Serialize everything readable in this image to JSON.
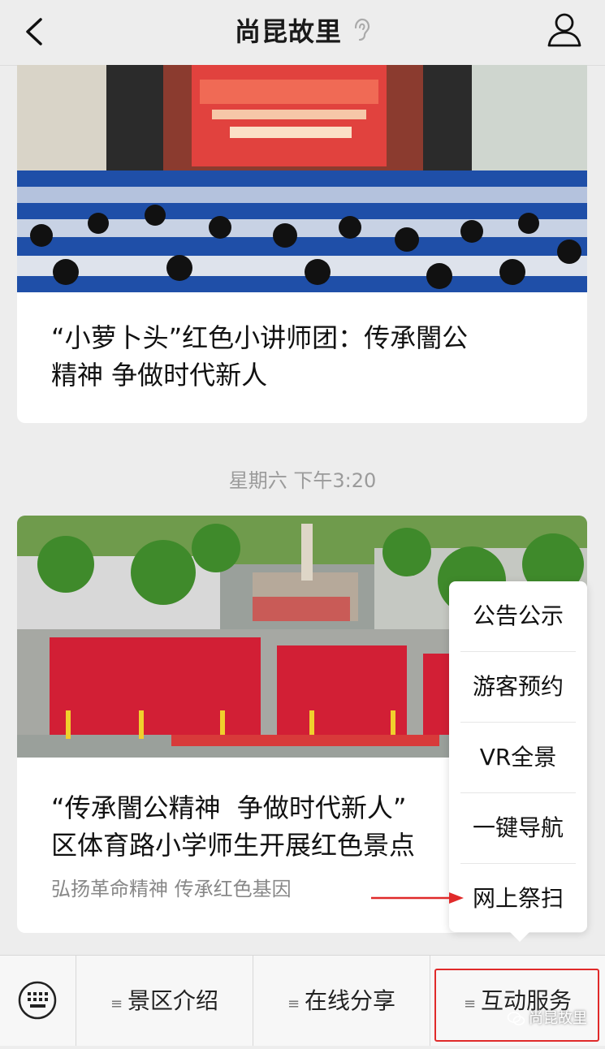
{
  "header": {
    "title": "尚昆故里"
  },
  "articles": [
    {
      "title": "“小萝卜头”红色小讲师团：传承闇公\n精神 争做时代新人"
    },
    {
      "title": "“传承闇公精神  争做时代新人”\n区体育路小学师生开展红色景点",
      "subtitle": "弘扬革命精神  传承红色基因"
    }
  ],
  "timestamp": "星期六 下午3:20",
  "popup_menu": {
    "items": [
      "公告公示",
      "游客预约",
      "VR全景",
      "一键导航",
      "网上祭扫"
    ]
  },
  "bottom_menu": {
    "items": [
      "景区介绍",
      "在线分享",
      "互动服务"
    ]
  },
  "watermark": "尚昆故里",
  "colors": {
    "highlight": "#e02a2a",
    "background": "#ededed"
  }
}
